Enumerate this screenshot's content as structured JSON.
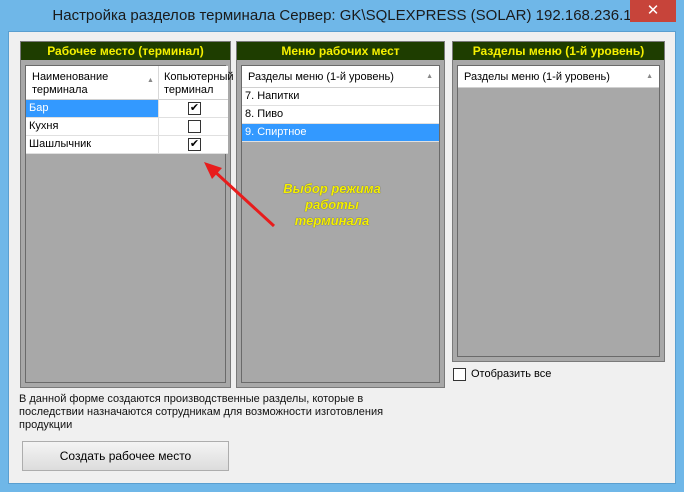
{
  "window": {
    "title": "Настройка разделов терминала  Сервер: GK\\SQLEXPRESS (SOLAR) 192.168.236.1",
    "close_label": "✕"
  },
  "panel_workplace": {
    "header": "Рабочее место (терминал)",
    "columns": [
      "Наименование терминала",
      "Копьютерный терминал"
    ],
    "rows": [
      {
        "name": "Бар",
        "checked": true,
        "selected": true
      },
      {
        "name": "Кухня",
        "checked": false,
        "selected": false
      },
      {
        "name": "Шашлычник",
        "checked": true,
        "selected": false
      }
    ]
  },
  "panel_menus": {
    "header": "Меню рабочих мест",
    "column": "Разделы меню (1-й уровень)",
    "items": [
      {
        "label": "7. Напитки",
        "selected": false
      },
      {
        "label": "8. Пиво",
        "selected": false
      },
      {
        "label": "9. Спиртное",
        "selected": true
      }
    ]
  },
  "panel_sections": {
    "header": "Разделы меню (1-й уровень)",
    "column": "Разделы меню (1-й уровень)"
  },
  "show_all_label": "Отобразить все",
  "description": "В данной форме создаются производственные разделы, которые в последствии назначаются сотрудникам для возможности изготовления продукции",
  "create_button_label": "Создать рабочее место",
  "annotation": "Выбор режима работы терминала",
  "colors": {
    "panel_header_bg": "#1e3d00",
    "panel_header_text": "#f5f000",
    "selection": "#3399ff",
    "annotation_arrow": "#e81c1c"
  }
}
